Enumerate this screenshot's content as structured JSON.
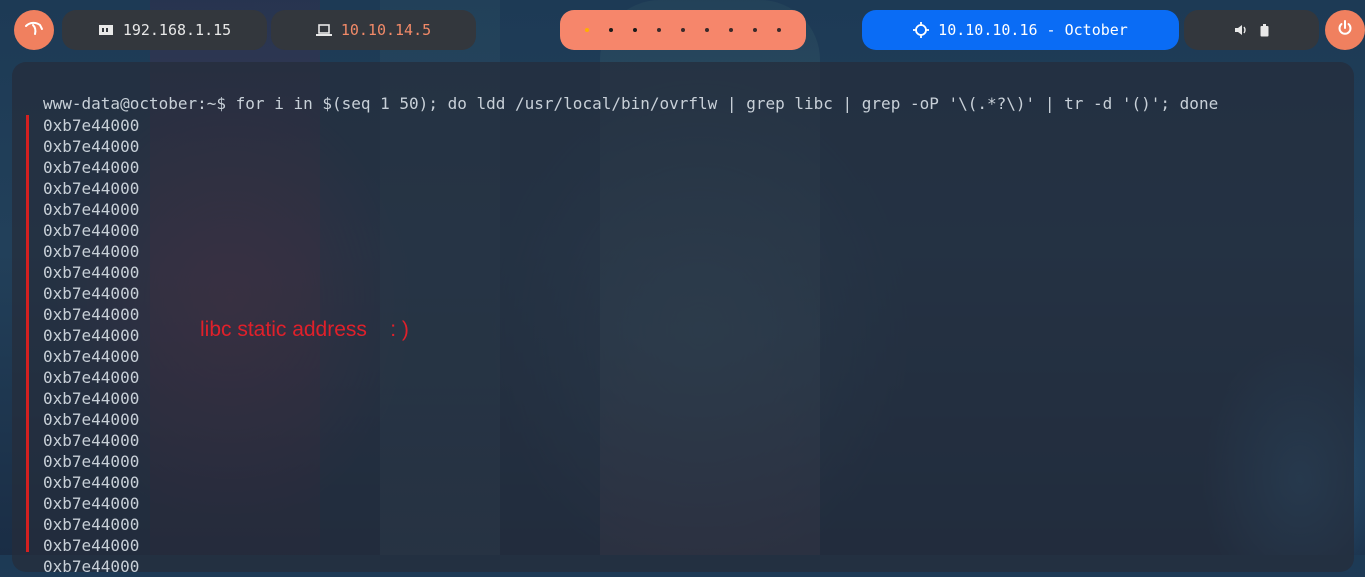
{
  "topbar": {
    "home_ip": "192.168.1.15",
    "vpn_ip": "10.10.14.5",
    "workspace_dots": [
      "#ffb000",
      "#1a1a1a",
      "#1a1a1a",
      "#3a2a2a",
      "#3a2a2a",
      "#3a2a2a",
      "#3a2a2a",
      "#3a2a2a",
      "#3a2a2a"
    ],
    "target": "10.10.10.16 - October"
  },
  "colors": {
    "accent": "#f0805f",
    "target_bg": "#0a6cf5",
    "annotation": "#e0202a",
    "vpn_text": "#f28a68"
  },
  "terminal": {
    "prompt": "www-data@october:~$ for i in $(seq 1 50); do ldd /usr/local/bin/ovrflw | grep libc | grep -oP '\\(.*?\\)' | tr -d '()'; done",
    "output_lines": [
      "0xb7e44000",
      "0xb7e44000",
      "0xb7e44000",
      "0xb7e44000",
      "0xb7e44000",
      "0xb7e44000",
      "0xb7e44000",
      "0xb7e44000",
      "0xb7e44000",
      "0xb7e44000",
      "0xb7e44000",
      "0xb7e44000",
      "0xb7e44000",
      "0xb7e44000",
      "0xb7e44000",
      "0xb7e44000",
      "0xb7e44000",
      "0xb7e44000",
      "0xb7e44000",
      "0xb7e44000",
      "0xb7e44000",
      "0xb7e44000"
    ],
    "annotation": "libc static address    : )"
  }
}
